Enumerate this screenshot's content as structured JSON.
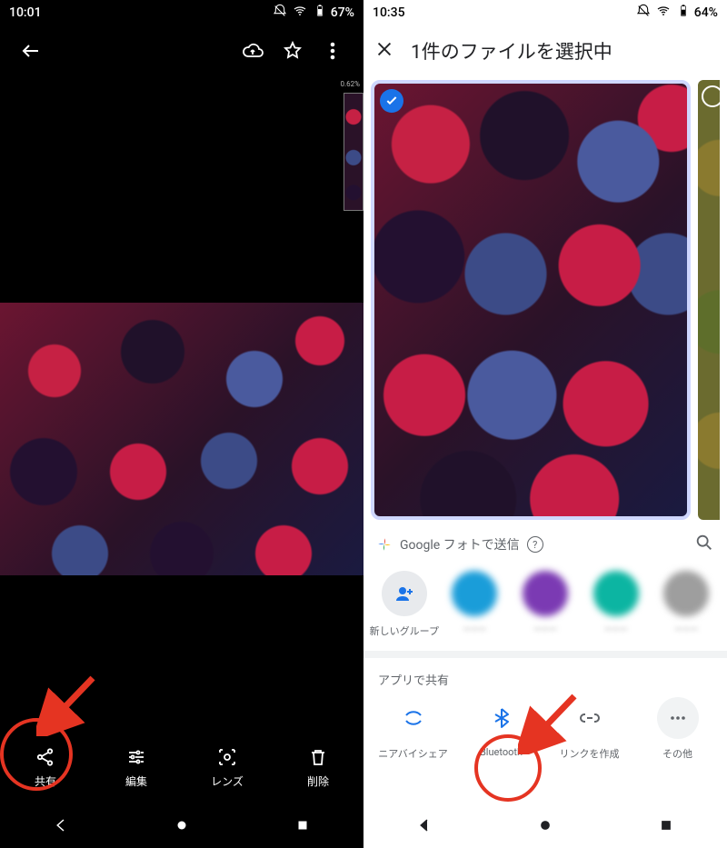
{
  "left": {
    "status": {
      "time": "10:01",
      "battery": "67%"
    },
    "thumb_badge": "0.62%",
    "actions": {
      "share": "共有",
      "edit": "編集",
      "lens": "レンズ",
      "delete": "削除"
    }
  },
  "right": {
    "status": {
      "time": "10:35",
      "battery": "64%"
    },
    "title": "1件のファイルを選択中",
    "send_with_photos": "Google フォトで送信",
    "contacts": {
      "new_group": "新しいグループ"
    },
    "app_share_section": "アプリで共有",
    "apps": {
      "nearby": "ニアバイシェア",
      "bluetooth": "Bluetooth",
      "link": "リンクを作成",
      "more": "その他"
    }
  }
}
